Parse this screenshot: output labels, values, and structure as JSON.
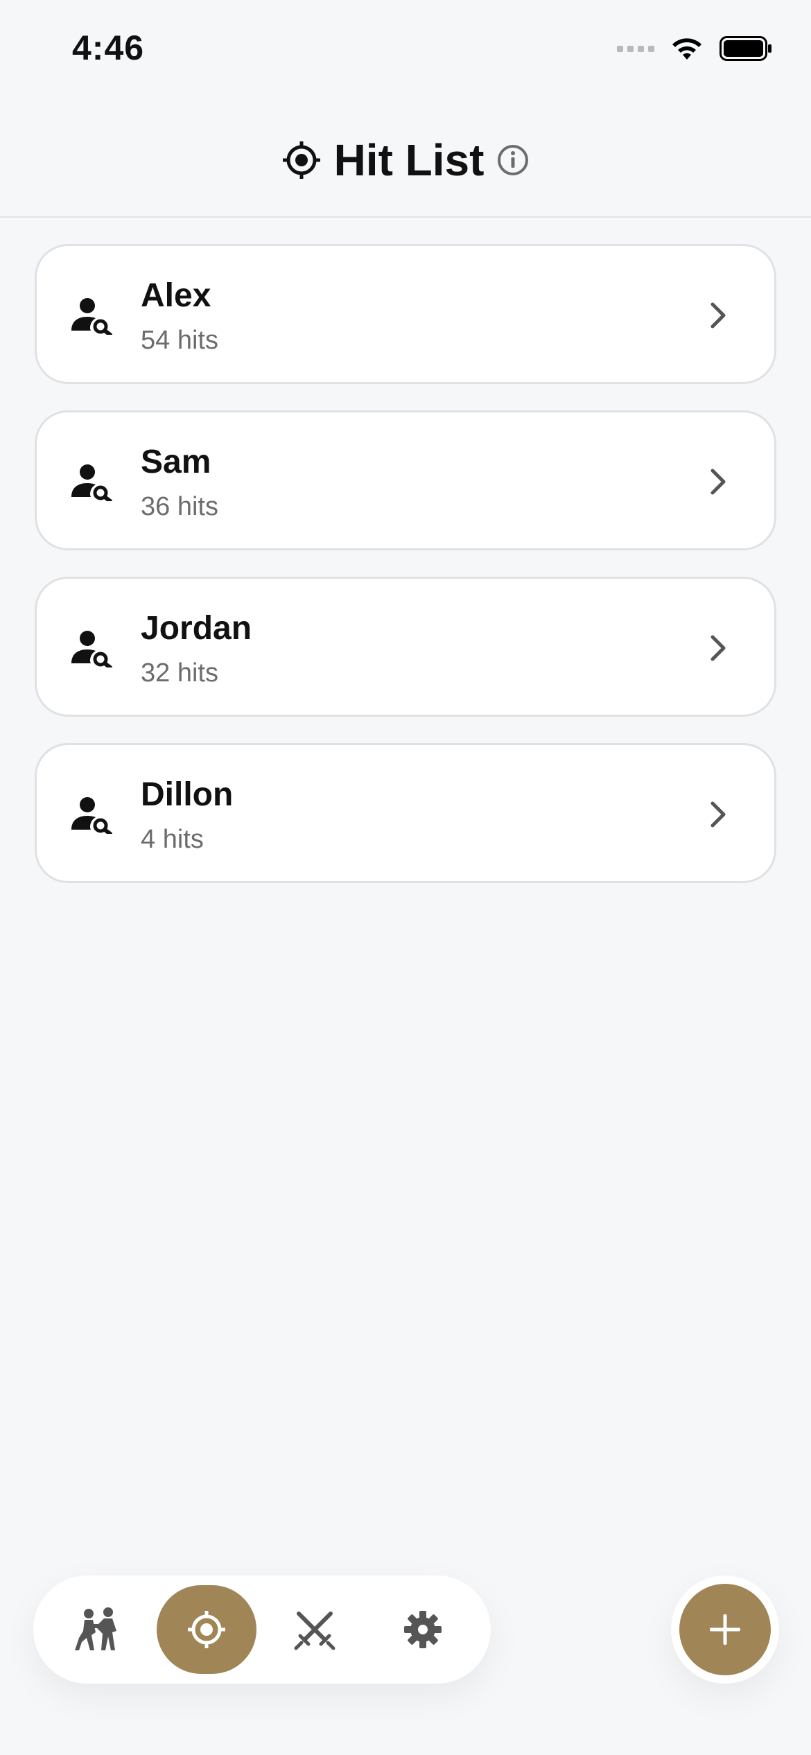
{
  "status_bar": {
    "time": "4:46",
    "icons": [
      "cellular-signal-icon",
      "wifi-icon",
      "battery-icon"
    ]
  },
  "header": {
    "title": "Hit List",
    "title_icon": "crosshair-icon",
    "info_icon": "info-icon"
  },
  "list": {
    "items": [
      {
        "name": "Alex",
        "hits": "54 hits",
        "icon": "person-search-icon"
      },
      {
        "name": "Sam",
        "hits": "36 hits",
        "icon": "person-search-icon"
      },
      {
        "name": "Jordan",
        "hits": "32 hits",
        "icon": "person-search-icon"
      },
      {
        "name": "Dillon",
        "hits": "4 hits",
        "icon": "person-search-icon"
      }
    ]
  },
  "tabbar": {
    "tabs": [
      {
        "icon": "fight-icon",
        "active": false
      },
      {
        "icon": "crosshair-icon",
        "active": true
      },
      {
        "icon": "crossed-swords-icon",
        "active": false
      },
      {
        "icon": "gear-icon",
        "active": false
      }
    ]
  },
  "fab": {
    "icon": "plus-icon"
  },
  "colors": {
    "accent": "#a08556",
    "background": "#f6f7f9",
    "card": "#ffffff",
    "secondary_text": "#6c6c6c"
  }
}
